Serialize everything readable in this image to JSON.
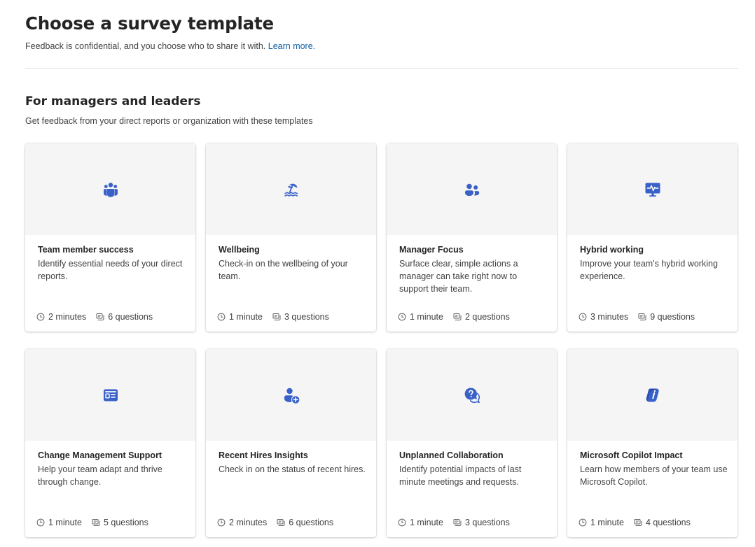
{
  "header": {
    "title": "Choose a survey template",
    "subtitle": "Feedback is confidential, and you choose who to share it with.",
    "learn_more": "Learn more."
  },
  "section": {
    "title": "For managers and leaders",
    "subtitle": "Get feedback from your direct reports or organization with these templates"
  },
  "colors": {
    "accent": "#3a61c8",
    "link": "#115ea3",
    "hero_bg": "#f5f5f5"
  },
  "cards": [
    {
      "icon": "team-icon",
      "title": "Team member success",
      "description": "Identify essential needs of your direct reports.",
      "duration": "2 minutes",
      "questions": "6 questions"
    },
    {
      "icon": "beach-umbrella-icon",
      "title": "Wellbeing",
      "description": "Check-in on the wellbeing of your team.",
      "duration": "1 minute",
      "questions": "3 questions"
    },
    {
      "icon": "people-icon",
      "title": "Manager Focus",
      "description": "Surface clear, simple actions a manager can take right now to support their team.",
      "duration": "1 minute",
      "questions": "2 questions"
    },
    {
      "icon": "desktop-pulse-icon",
      "title": "Hybrid working",
      "description": "Improve your team's hybrid working experience.",
      "duration": "3 minutes",
      "questions": "9 questions"
    },
    {
      "icon": "news-icon",
      "title": "Change Management Support",
      "description": "Help your team adapt and thrive through change.",
      "duration": "1 minute",
      "questions": "5 questions"
    },
    {
      "icon": "person-add-icon",
      "title": "Recent Hires Insights",
      "description": "Check in on the status of recent hires.",
      "duration": "2 minutes",
      "questions": "6 questions"
    },
    {
      "icon": "chat-question-icon",
      "title": "Unplanned Collaboration",
      "description": "Identify potential impacts of last minute meetings and requests.",
      "duration": "1 minute",
      "questions": "3 questions"
    },
    {
      "icon": "copilot-icon",
      "title": "Microsoft Copilot Impact",
      "description": "Learn how members of your team use Microsoft Copilot.",
      "duration": "1 minute",
      "questions": "4 questions"
    }
  ]
}
